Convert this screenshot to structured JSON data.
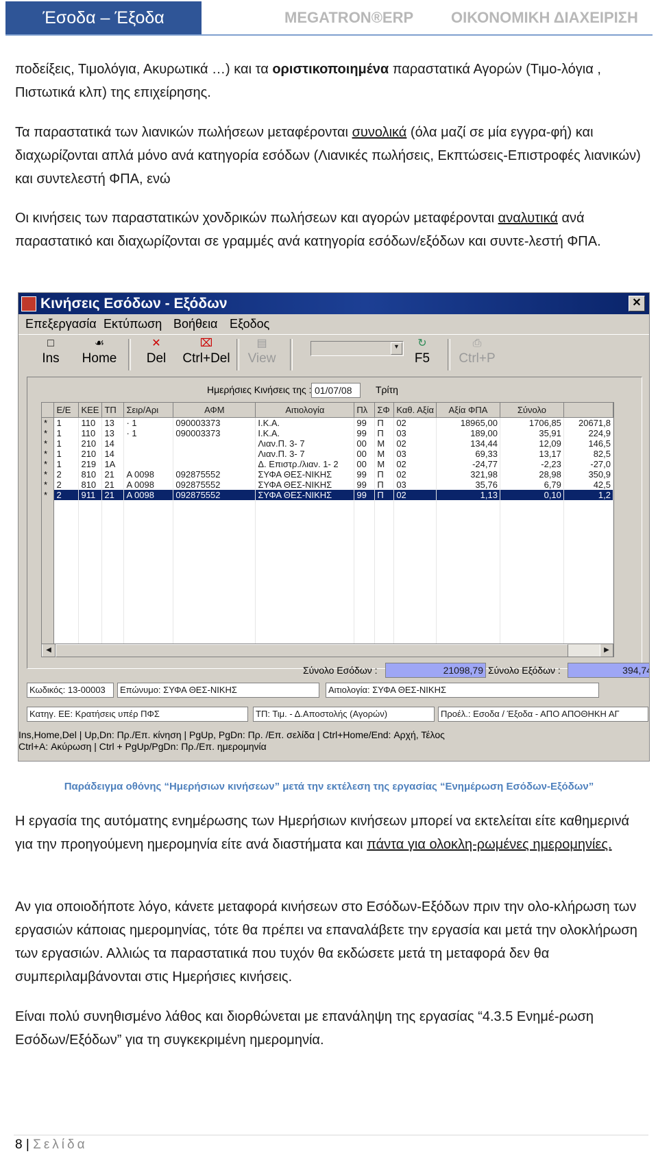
{
  "header": {
    "tab": "Έσοδα – Έξοδα",
    "brand": "MEGATRON®ERP",
    "section": "ΟΙΚΟΝΟΜΙΚΗ ΔΙΑΧΕΙΡΙΣΗ"
  },
  "p1": {
    "a": "ποδείξεις, Τιμολόγια, Ακυρωτικά …) και τα ",
    "b": "οριστικοποιημένα",
    "c": " παραστατικά Αγορών (Τιμο-λόγια , Πιστωτικά κλπ) της επιχείρησης."
  },
  "p2": {
    "a": "Τα παραστατικά των λιανικών πωλήσεων μεταφέρονται ",
    "b": "συνολικά",
    "c": " (όλα μαζί σε μία εγγρα-φή) και διαχωρίζονται απλά μόνο ανά κατηγορία εσόδων (Λιανικές πωλήσεις, Εκπτώσεις-Επιστροφές  λιανικών) και συντελεστή ΦΠΑ, ενώ"
  },
  "p3": {
    "a": "Οι κινήσεις των παραστατικών χονδρικών πωλήσεων και αγορών μεταφέρονται ",
    "b": "αναλυτικά",
    "c": " ανά παραστατικό και διαχωρίζονται σε γραμμές ανά κατηγορία εσόδων/εξόδων και συντε-λεστή ΦΠΑ."
  },
  "window": {
    "title": "Κινήσεις Εσόδων - Εξόδων",
    "close": "✕",
    "menu": [
      "Επεξεργασία",
      "Εκτύπωση",
      "Βοήθεια",
      "Εξοδος"
    ],
    "toolbar": {
      "ins": "Ins",
      "home": "Home",
      "del": "Del",
      "ctrldel": "Ctrl+Del",
      "view": "View",
      "f5": "F5",
      "ctrlp": "Ctrl+P"
    },
    "date_label": "Ημερήσιες Κινήσεις της :",
    "date_value": "01/07/08",
    "day_name": "Τρίτη",
    "columns": [
      "Ε/Ε",
      "ΚΕΕ",
      "ΤΠ",
      "Σειρ/Αρι",
      "ΑΦΜ",
      "Αιτιολογία",
      "Πλ",
      "ΣΦ",
      "Καθ. Αξία",
      "Αξία ΦΠΑ",
      "Σύνολο"
    ],
    "rows": [
      [
        "*",
        "1",
        "110",
        "13",
        "·      1",
        "090003373",
        "I.K.A.",
        "99",
        "Π",
        "02",
        "18965,00",
        "1706,85",
        "20671,8"
      ],
      [
        "*",
        "1",
        "110",
        "13",
        "·      1",
        "090003373",
        "I.K.A.",
        "99",
        "Π",
        "03",
        "189,00",
        "35,91",
        "224,9"
      ],
      [
        "*",
        "1",
        "210",
        "14",
        "",
        "",
        "Λιαν.Π.       3-        7",
        "00",
        "Μ",
        "02",
        "134,44",
        "12,09",
        "146,5"
      ],
      [
        "*",
        "1",
        "210",
        "14",
        "",
        "",
        "Λιαν.Π.       3-        7",
        "00",
        "Μ",
        "03",
        "69,33",
        "13,17",
        "82,5"
      ],
      [
        "*",
        "1",
        "219",
        "1A",
        "",
        "",
        "Δ. Επιστρ./λιαν. 1-      2",
        "00",
        "Μ",
        "02",
        "-24,77",
        "-2,23",
        "-27,0"
      ],
      [
        "*",
        "2",
        "810",
        "21",
        "A  0098",
        "092875552",
        "ΣΥΦΑ ΘΕΣ-ΝΙΚΗΣ",
        "99",
        "Π",
        "02",
        "321,98",
        "28,98",
        "350,9"
      ],
      [
        "*",
        "2",
        "810",
        "21",
        "A  0098",
        "092875552",
        "ΣΥΦΑ ΘΕΣ-ΝΙΚΗΣ",
        "99",
        "Π",
        "03",
        "35,76",
        "6,79",
        "42,5"
      ],
      [
        "*",
        "2",
        "911",
        "21",
        "A  0098",
        "092875552",
        "ΣΥΦΑ ΘΕΣ-ΝΙΚΗΣ",
        "99",
        "Π",
        "02",
        "1,13",
        "0,10",
        "1,2"
      ]
    ],
    "total_in_label": "Σύνολο Εσόδων :",
    "total_in": "21098,79",
    "total_out_label": "Σύνολο Εξόδων :",
    "total_out": "394,74",
    "code": "Κωδικός: 13-00003",
    "name": "Επώνυμο: ΣΥΦΑ ΘΕΣ-ΝΙΚΗΣ",
    "reason": "Αιτιολογία: ΣΥΦΑ ΘΕΣ-ΝΙΚΗΣ",
    "category": "Κατηγ. ΕΕ: Κρατήσεις υπέρ ΠΦΣ",
    "doctype": "ΤΠ: Τιμ. - Δ.Αποστολής       (Αγορών)",
    "origin": "Προέλ.: Εσοδα / Έξοδα - ΑΠΟ ΑΠΟΘΗΚΗ ΑΓ",
    "status1": "Ins,Home,Del  |  Up,Dn: Πρ./Επ. κίνηση  |  PgUp, PgDn: Πρ. /Επ. σελίδα  |  Ctrl+Home/End: Αρχή, Τέλος",
    "status2": "Ctrl+A: Ακύρωση  |  Ctrl + PgUp/PgDn: Πρ./Επ. ημερομηνία"
  },
  "caption": "Παράδειγμα οθόνης “Ημερήσιων κινήσεων” μετά την εκτέλεση της εργασίας “Ενημέρωση Εσόδων-Εξόδων”",
  "p4": {
    "a": "Η εργασία της αυτόματης ενημέρωσης των Ημερήσιων κινήσεων μπορεί να εκτελείται είτε καθημερινά για την προηγούμενη ημερομηνία είτε ανά διαστήματα και ",
    "b": "πάντα για ολοκλη-ρωμένες ημερομηνίες."
  },
  "p5": "Αν για οποιοδήποτε λόγο, κάνετε μεταφορά κινήσεων στο Εσόδων-Εξόδων πριν την ολο-κλήρωση των εργασιών κάποιας ημερομηνίας, τότε θα πρέπει να επαναλάβετε την εργασία και μετά την ολοκλήρωση των εργασιών. Αλλιώς τα παραστατικά που τυχόν θα εκδώσετε μετά τη μεταφορά δεν θα συμπεριλαμβάνονται στις Ημερήσιες κινήσεις.",
  "p6": "Είναι πολύ συνηθισμένο λάθος και διορθώνεται με επανάληψη της εργασίας “4.3.5 Ενημέ-ρωση Εσόδων/Εξόδων” για τη συγκεκριμένη ημερομηνία.",
  "footer": {
    "page": "8",
    "sep": " | ",
    "label": "Σελίδα"
  }
}
